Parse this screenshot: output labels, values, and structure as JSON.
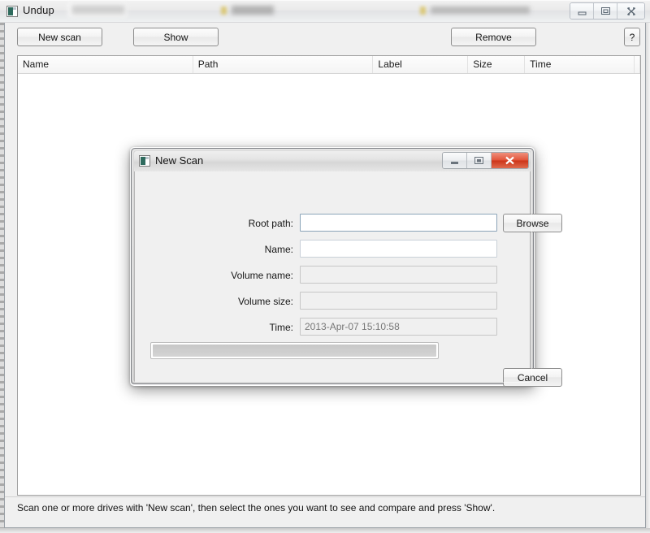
{
  "main_window": {
    "title": "Undup",
    "icon": "app-icon",
    "titlebar_obscured": [
      {
        "text": "blurred-text-1"
      },
      {
        "text": "blurred-text-2"
      },
      {
        "text": "blurred-text-3"
      }
    ],
    "window_buttons": [
      {
        "name": "minimize",
        "glyph": "minimize-icon"
      },
      {
        "name": "maximize",
        "glyph": "restore-icon"
      },
      {
        "name": "close",
        "glyph": "close-icon"
      }
    ]
  },
  "toolbar": {
    "new_scan_label": "New scan",
    "show_label": "Show",
    "remove_label": "Remove",
    "help_label": "?"
  },
  "list_view": {
    "columns": [
      {
        "key": "name",
        "label": "Name"
      },
      {
        "key": "path",
        "label": "Path"
      },
      {
        "key": "label",
        "label": "Label"
      },
      {
        "key": "size",
        "label": "Size"
      },
      {
        "key": "time",
        "label": "Time"
      }
    ],
    "rows": []
  },
  "status_bar": {
    "message": "Scan one or more drives with 'New scan', then select the ones you want to see and compare and press 'Show'."
  },
  "dialog": {
    "title": "New Scan",
    "icon": "app-icon",
    "window_buttons": [
      {
        "name": "minimize",
        "glyph": "minimize-icon"
      },
      {
        "name": "maximize",
        "glyph": "restore-icon"
      },
      {
        "name": "close",
        "glyph": "close-icon"
      }
    ],
    "fields": [
      {
        "key": "root_path",
        "label": "Root path:",
        "value": "",
        "placeholder": "",
        "state": "focused"
      },
      {
        "key": "name",
        "label": "Name:",
        "value": "",
        "placeholder": "",
        "state": "editable"
      },
      {
        "key": "volume_name",
        "label": "Volume name:",
        "value": "",
        "placeholder": "",
        "state": "readonly"
      },
      {
        "key": "volume_size",
        "label": "Volume size:",
        "value": "",
        "placeholder": "",
        "state": "readonly"
      },
      {
        "key": "time",
        "label": "Time:",
        "value": "2013-Apr-07 15:10:58",
        "placeholder": "",
        "state": "readonly"
      }
    ],
    "browse_label": "Browse",
    "cancel_label": "Cancel",
    "progress": {
      "percent": 0,
      "label": ""
    }
  },
  "colors": {
    "window_bg": "#f0f0f0",
    "list_bg": "#ffffff",
    "border": "#9aa0a6",
    "close_red": "#cc3518",
    "focus_border": "#8ba4b8",
    "readonly_text": "#777777",
    "icon_green": "#2f6b5e"
  }
}
